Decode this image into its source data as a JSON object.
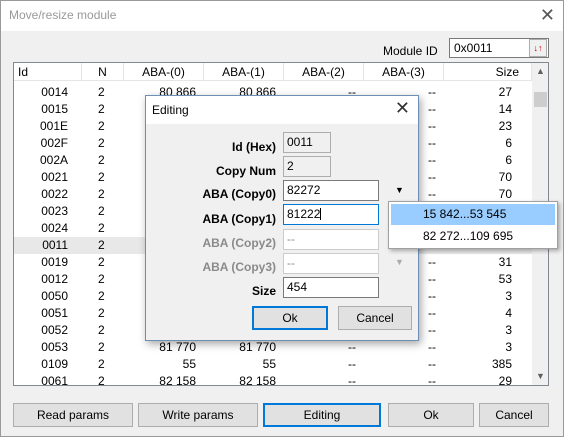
{
  "window": {
    "title": "Move/resize module",
    "close_glyph": "✕"
  },
  "module_id": {
    "label": "Module ID",
    "value": "0x0011",
    "button_icon": "↓↑"
  },
  "table": {
    "columns": [
      "Id",
      "N",
      "ABA-(0)",
      "ABA-(1)",
      "ABA-(2)",
      "ABA-(3)",
      "Size"
    ],
    "rows": [
      {
        "id": "0014",
        "n": "2",
        "a0": "80 866",
        "a1": "80 866",
        "a2": "--",
        "a3": "--",
        "size": "27"
      },
      {
        "id": "0015",
        "n": "2",
        "a0": "",
        "a1": "",
        "a2": "",
        "a3": "--",
        "size": "14"
      },
      {
        "id": "001E",
        "n": "2",
        "a0": "",
        "a1": "",
        "a2": "",
        "a3": "--",
        "size": "23"
      },
      {
        "id": "002F",
        "n": "2",
        "a0": "",
        "a1": "",
        "a2": "",
        "a3": "--",
        "size": "6"
      },
      {
        "id": "002A",
        "n": "2",
        "a0": "",
        "a1": "",
        "a2": "",
        "a3": "--",
        "size": "6"
      },
      {
        "id": "0021",
        "n": "2",
        "a0": "",
        "a1": "",
        "a2": "",
        "a3": "--",
        "size": "70"
      },
      {
        "id": "0022",
        "n": "2",
        "a0": "",
        "a1": "",
        "a2": "",
        "a3": "--",
        "size": "70"
      },
      {
        "id": "0023",
        "n": "2",
        "a0": "",
        "a1": "",
        "a2": "",
        "a3": "",
        "size": ""
      },
      {
        "id": "0024",
        "n": "2",
        "a0": "",
        "a1": "",
        "a2": "",
        "a3": "",
        "size": ""
      },
      {
        "id": "0011",
        "n": "2",
        "a0": "",
        "a1": "",
        "a2": "",
        "a3": "",
        "size": ""
      },
      {
        "id": "0019",
        "n": "2",
        "a0": "",
        "a1": "",
        "a2": "",
        "a3": "--",
        "size": "31"
      },
      {
        "id": "0012",
        "n": "2",
        "a0": "",
        "a1": "",
        "a2": "",
        "a3": "--",
        "size": "53"
      },
      {
        "id": "0050",
        "n": "2",
        "a0": "",
        "a1": "",
        "a2": "",
        "a3": "--",
        "size": "3"
      },
      {
        "id": "0051",
        "n": "2",
        "a0": "",
        "a1": "",
        "a2": "",
        "a3": "--",
        "size": "4"
      },
      {
        "id": "0052",
        "n": "2",
        "a0": "",
        "a1": "",
        "a2": "",
        "a3": "--",
        "size": "3"
      },
      {
        "id": "0053",
        "n": "2",
        "a0": "81 770",
        "a1": "81 770",
        "a2": "--",
        "a3": "--",
        "size": "3"
      },
      {
        "id": "0109",
        "n": "2",
        "a0": "55",
        "a1": "55",
        "a2": "--",
        "a3": "--",
        "size": "385"
      },
      {
        "id": "0061",
        "n": "2",
        "a0": "82 158",
        "a1": "82 158",
        "a2": "--",
        "a3": "--",
        "size": "29"
      }
    ],
    "selected_row": 9
  },
  "buttons": {
    "read_params": "Read params",
    "write_params": "Write params",
    "editing": "Editing",
    "ok": "Ok",
    "cancel": "Cancel"
  },
  "dialog": {
    "title": "Editing",
    "close_glyph": "✕",
    "fields": {
      "id_hex": {
        "label": "Id (Hex)",
        "value": "0011"
      },
      "copy_num": {
        "label": "Copy Num",
        "value": "2"
      },
      "aba0": {
        "label": "ABA (Copy0)",
        "value": "82272"
      },
      "aba1": {
        "label": "ABA (Copy1)",
        "value": "81222"
      },
      "aba2": {
        "label": "ABA (Copy2)",
        "value": "--"
      },
      "aba3": {
        "label": "ABA (Copy3)",
        "value": "--"
      },
      "size": {
        "label": "Size",
        "value": "454"
      }
    },
    "ok": "Ok",
    "cancel": "Cancel",
    "dropdown_options": [
      "15 842...53 545",
      "82 272...109 695"
    ],
    "dropdown_highlighted": 0
  },
  "colors": {
    "highlight": "#99ccff",
    "selected_row": "#e8e8e8",
    "focus_border": "#0078d7"
  }
}
